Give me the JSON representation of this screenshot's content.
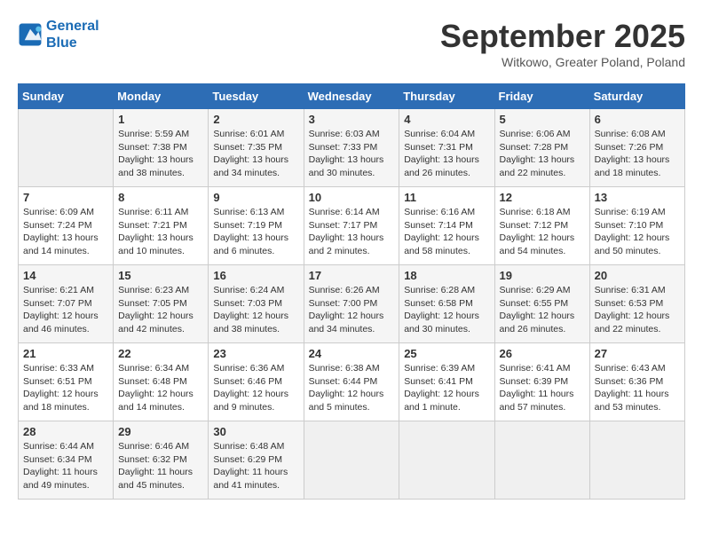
{
  "header": {
    "logo_line1": "General",
    "logo_line2": "Blue",
    "month": "September 2025",
    "location": "Witkowo, Greater Poland, Poland"
  },
  "weekdays": [
    "Sunday",
    "Monday",
    "Tuesday",
    "Wednesday",
    "Thursday",
    "Friday",
    "Saturday"
  ],
  "weeks": [
    [
      {
        "day": "",
        "sunrise": "",
        "sunset": "",
        "daylight": ""
      },
      {
        "day": "1",
        "sunrise": "Sunrise: 5:59 AM",
        "sunset": "Sunset: 7:38 PM",
        "daylight": "Daylight: 13 hours and 38 minutes."
      },
      {
        "day": "2",
        "sunrise": "Sunrise: 6:01 AM",
        "sunset": "Sunset: 7:35 PM",
        "daylight": "Daylight: 13 hours and 34 minutes."
      },
      {
        "day": "3",
        "sunrise": "Sunrise: 6:03 AM",
        "sunset": "Sunset: 7:33 PM",
        "daylight": "Daylight: 13 hours and 30 minutes."
      },
      {
        "day": "4",
        "sunrise": "Sunrise: 6:04 AM",
        "sunset": "Sunset: 7:31 PM",
        "daylight": "Daylight: 13 hours and 26 minutes."
      },
      {
        "day": "5",
        "sunrise": "Sunrise: 6:06 AM",
        "sunset": "Sunset: 7:28 PM",
        "daylight": "Daylight: 13 hours and 22 minutes."
      },
      {
        "day": "6",
        "sunrise": "Sunrise: 6:08 AM",
        "sunset": "Sunset: 7:26 PM",
        "daylight": "Daylight: 13 hours and 18 minutes."
      }
    ],
    [
      {
        "day": "7",
        "sunrise": "Sunrise: 6:09 AM",
        "sunset": "Sunset: 7:24 PM",
        "daylight": "Daylight: 13 hours and 14 minutes."
      },
      {
        "day": "8",
        "sunrise": "Sunrise: 6:11 AM",
        "sunset": "Sunset: 7:21 PM",
        "daylight": "Daylight: 13 hours and 10 minutes."
      },
      {
        "day": "9",
        "sunrise": "Sunrise: 6:13 AM",
        "sunset": "Sunset: 7:19 PM",
        "daylight": "Daylight: 13 hours and 6 minutes."
      },
      {
        "day": "10",
        "sunrise": "Sunrise: 6:14 AM",
        "sunset": "Sunset: 7:17 PM",
        "daylight": "Daylight: 13 hours and 2 minutes."
      },
      {
        "day": "11",
        "sunrise": "Sunrise: 6:16 AM",
        "sunset": "Sunset: 7:14 PM",
        "daylight": "Daylight: 12 hours and 58 minutes."
      },
      {
        "day": "12",
        "sunrise": "Sunrise: 6:18 AM",
        "sunset": "Sunset: 7:12 PM",
        "daylight": "Daylight: 12 hours and 54 minutes."
      },
      {
        "day": "13",
        "sunrise": "Sunrise: 6:19 AM",
        "sunset": "Sunset: 7:10 PM",
        "daylight": "Daylight: 12 hours and 50 minutes."
      }
    ],
    [
      {
        "day": "14",
        "sunrise": "Sunrise: 6:21 AM",
        "sunset": "Sunset: 7:07 PM",
        "daylight": "Daylight: 12 hours and 46 minutes."
      },
      {
        "day": "15",
        "sunrise": "Sunrise: 6:23 AM",
        "sunset": "Sunset: 7:05 PM",
        "daylight": "Daylight: 12 hours and 42 minutes."
      },
      {
        "day": "16",
        "sunrise": "Sunrise: 6:24 AM",
        "sunset": "Sunset: 7:03 PM",
        "daylight": "Daylight: 12 hours and 38 minutes."
      },
      {
        "day": "17",
        "sunrise": "Sunrise: 6:26 AM",
        "sunset": "Sunset: 7:00 PM",
        "daylight": "Daylight: 12 hours and 34 minutes."
      },
      {
        "day": "18",
        "sunrise": "Sunrise: 6:28 AM",
        "sunset": "Sunset: 6:58 PM",
        "daylight": "Daylight: 12 hours and 30 minutes."
      },
      {
        "day": "19",
        "sunrise": "Sunrise: 6:29 AM",
        "sunset": "Sunset: 6:55 PM",
        "daylight": "Daylight: 12 hours and 26 minutes."
      },
      {
        "day": "20",
        "sunrise": "Sunrise: 6:31 AM",
        "sunset": "Sunset: 6:53 PM",
        "daylight": "Daylight: 12 hours and 22 minutes."
      }
    ],
    [
      {
        "day": "21",
        "sunrise": "Sunrise: 6:33 AM",
        "sunset": "Sunset: 6:51 PM",
        "daylight": "Daylight: 12 hours and 18 minutes."
      },
      {
        "day": "22",
        "sunrise": "Sunrise: 6:34 AM",
        "sunset": "Sunset: 6:48 PM",
        "daylight": "Daylight: 12 hours and 14 minutes."
      },
      {
        "day": "23",
        "sunrise": "Sunrise: 6:36 AM",
        "sunset": "Sunset: 6:46 PM",
        "daylight": "Daylight: 12 hours and 9 minutes."
      },
      {
        "day": "24",
        "sunrise": "Sunrise: 6:38 AM",
        "sunset": "Sunset: 6:44 PM",
        "daylight": "Daylight: 12 hours and 5 minutes."
      },
      {
        "day": "25",
        "sunrise": "Sunrise: 6:39 AM",
        "sunset": "Sunset: 6:41 PM",
        "daylight": "Daylight: 12 hours and 1 minute."
      },
      {
        "day": "26",
        "sunrise": "Sunrise: 6:41 AM",
        "sunset": "Sunset: 6:39 PM",
        "daylight": "Daylight: 11 hours and 57 minutes."
      },
      {
        "day": "27",
        "sunrise": "Sunrise: 6:43 AM",
        "sunset": "Sunset: 6:36 PM",
        "daylight": "Daylight: 11 hours and 53 minutes."
      }
    ],
    [
      {
        "day": "28",
        "sunrise": "Sunrise: 6:44 AM",
        "sunset": "Sunset: 6:34 PM",
        "daylight": "Daylight: 11 hours and 49 minutes."
      },
      {
        "day": "29",
        "sunrise": "Sunrise: 6:46 AM",
        "sunset": "Sunset: 6:32 PM",
        "daylight": "Daylight: 11 hours and 45 minutes."
      },
      {
        "day": "30",
        "sunrise": "Sunrise: 6:48 AM",
        "sunset": "Sunset: 6:29 PM",
        "daylight": "Daylight: 11 hours and 41 minutes."
      },
      {
        "day": "",
        "sunrise": "",
        "sunset": "",
        "daylight": ""
      },
      {
        "day": "",
        "sunrise": "",
        "sunset": "",
        "daylight": ""
      },
      {
        "day": "",
        "sunrise": "",
        "sunset": "",
        "daylight": ""
      },
      {
        "day": "",
        "sunrise": "",
        "sunset": "",
        "daylight": ""
      }
    ]
  ]
}
